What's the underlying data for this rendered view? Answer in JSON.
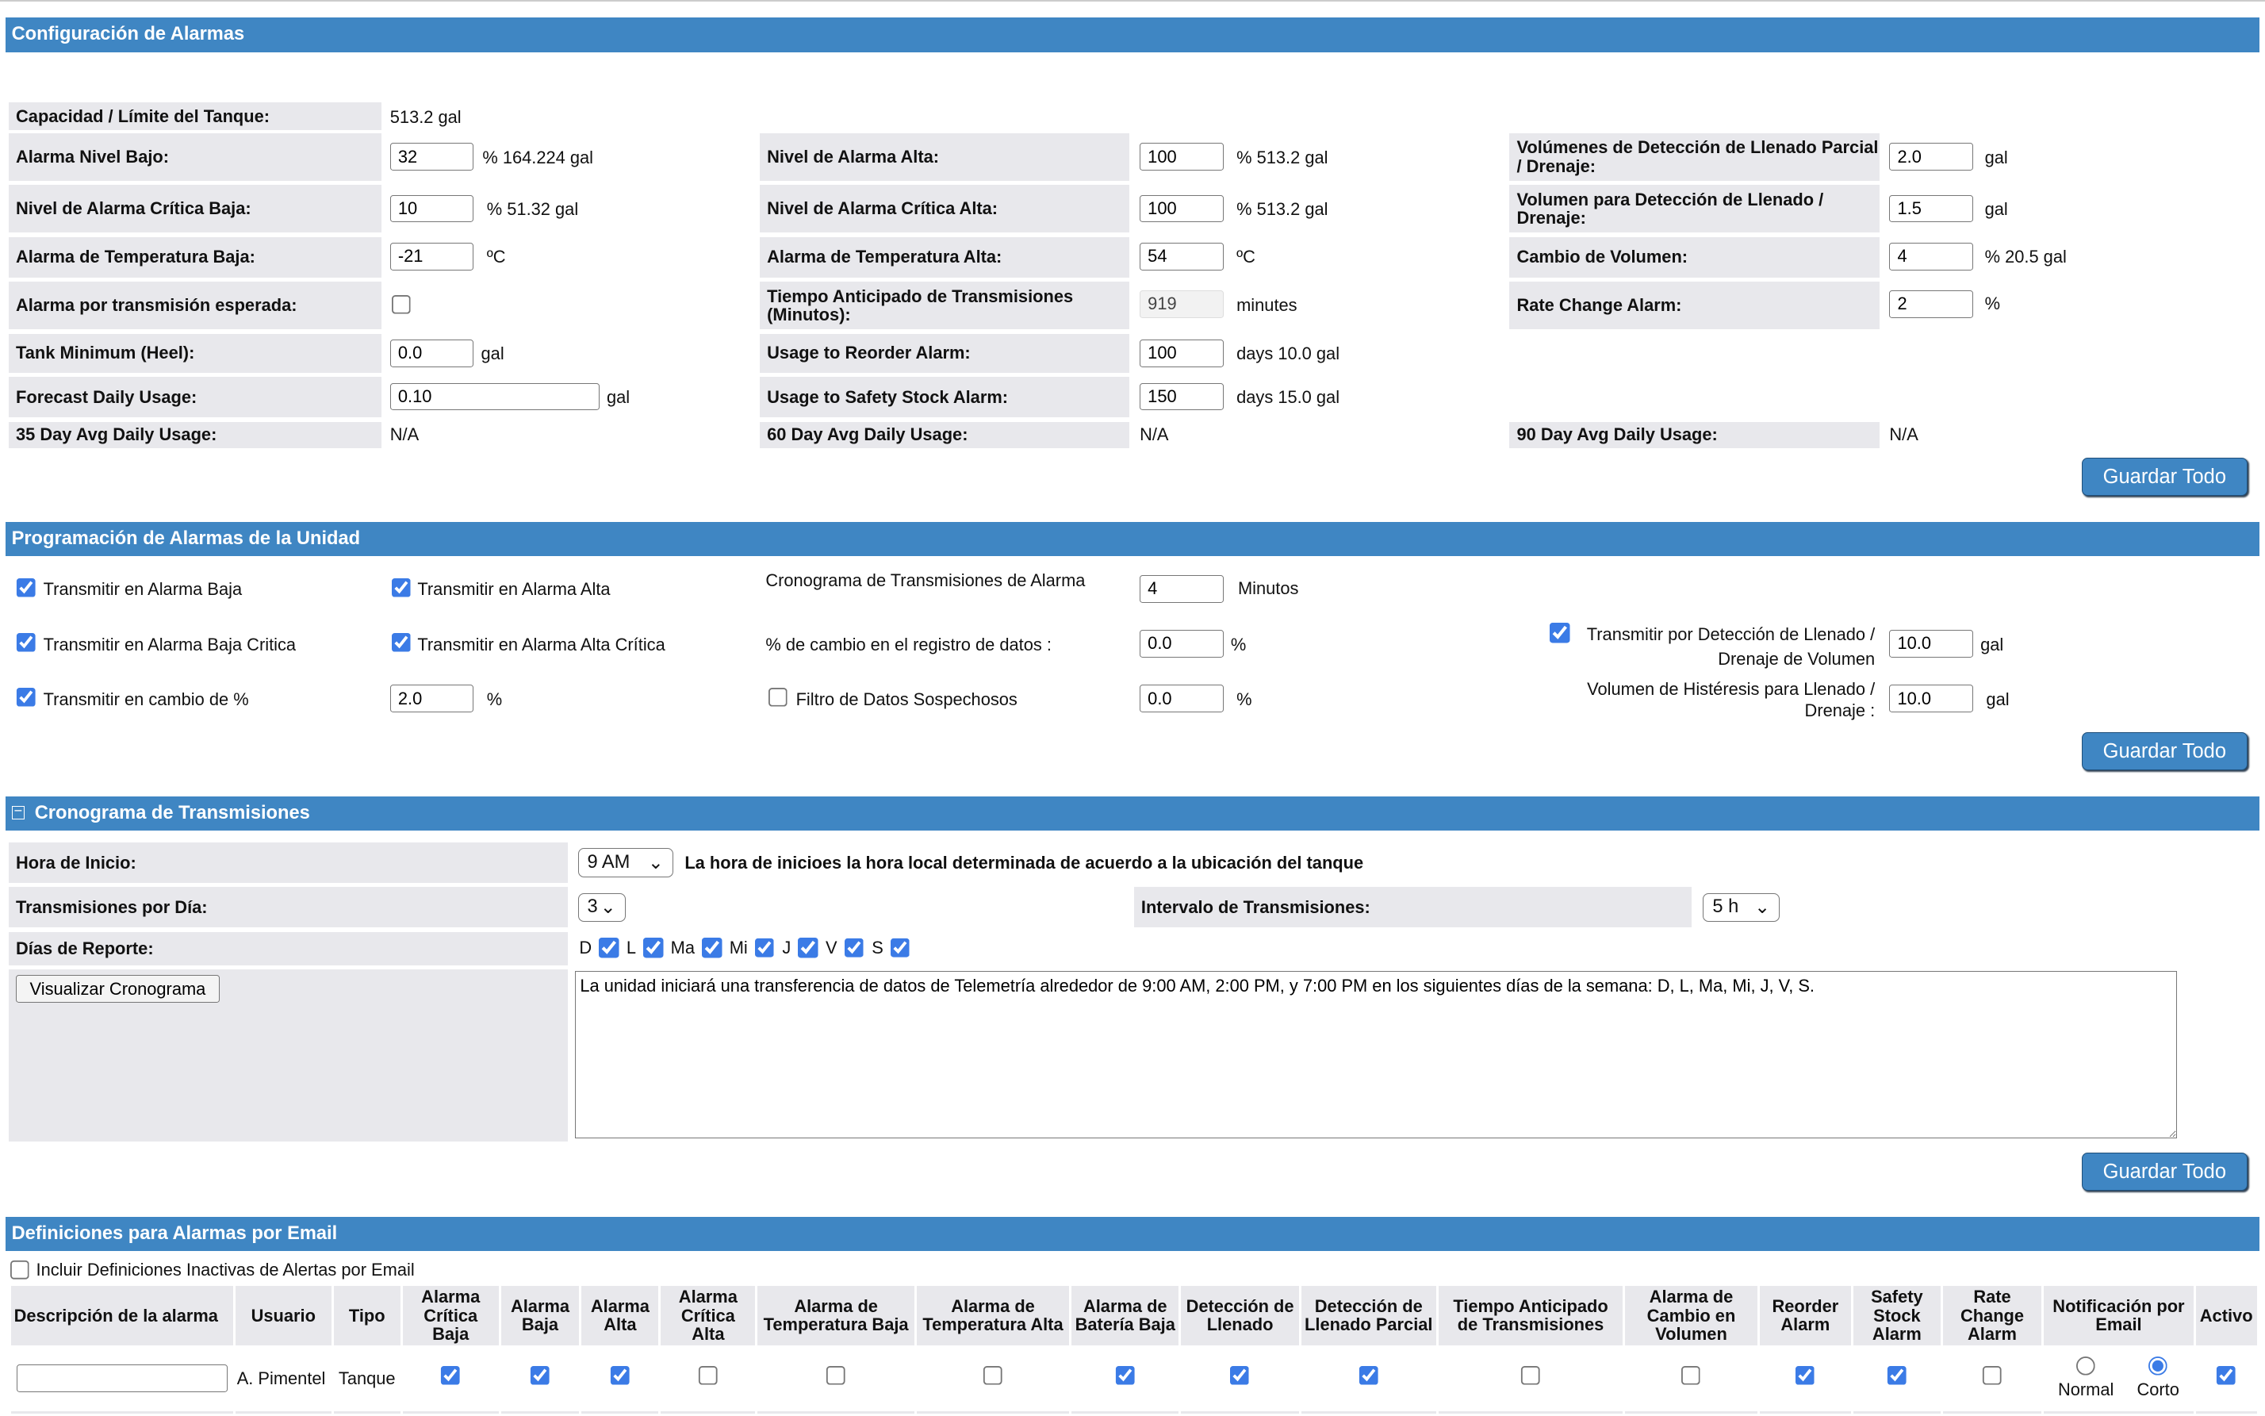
{
  "alarm_config": {
    "title": "Configuración de Alarmas",
    "capacity": {
      "label": "Capacidad / Límite del Tanque:",
      "value": "513.2  gal"
    },
    "low_alarm": {
      "label": "Alarma Nivel Bajo:",
      "value": "32",
      "suffix": "% 164.224  gal"
    },
    "crit_low": {
      "label": "Nivel de Alarma Crítica Baja:",
      "value": "10",
      "suffix": "%  51.32  gal"
    },
    "temp_low": {
      "label": "Alarma de Temperatura Baja:",
      "value": "-21",
      "suffix": "ºC"
    },
    "expected_tx": {
      "label": "Alarma por transmisión esperada:",
      "checked": false
    },
    "tank_min": {
      "label": "Tank Minimum (Heel):",
      "value": "0.0",
      "suffix": "gal"
    },
    "forecast": {
      "label": "Forecast Daily Usage:",
      "value": "0.10",
      "suffix": "gal"
    },
    "avg35": {
      "label": "35 Day Avg Daily Usage:",
      "value": "N/A"
    },
    "high_alarm": {
      "label": "Nivel de Alarma Alta:",
      "value": "100",
      "suffix": "%  513.2  gal"
    },
    "crit_high": {
      "label": "Nivel de Alarma Crítica Alta:",
      "value": "100",
      "suffix": "%  513.2  gal"
    },
    "temp_high": {
      "label": "Alarma de Temperatura Alta:",
      "value": "54",
      "suffix": "ºC"
    },
    "tx_lead": {
      "label": "Tiempo Anticipado de Transmisiones (Minutos):",
      "value": "919",
      "suffix": "minutes"
    },
    "reorder": {
      "label": "Usage to Reorder Alarm:",
      "value": "100",
      "suffix": "days 10.0 gal"
    },
    "safety": {
      "label": "Usage to Safety Stock Alarm:",
      "value": "150",
      "suffix": "days 15.0 gal"
    },
    "avg60": {
      "label": "60 Day Avg Daily Usage:",
      "value": "N/A"
    },
    "partial_fill": {
      "label": "Volúmenes de Detección de Llenado Parcial / Drenaje:",
      "value": "2.0",
      "suffix": "gal"
    },
    "fill_drain": {
      "label": "Volumen para Detección de Llenado / Drenaje:",
      "value": "1.5",
      "suffix": "gal"
    },
    "vol_change": {
      "label": "Cambio de Volumen:",
      "value": "4",
      "suffix": "%  20.5  gal"
    },
    "rate_change": {
      "label": "Rate Change Alarm:",
      "value": "2",
      "suffix": "%"
    },
    "avg90": {
      "label": "90 Day Avg Daily Usage:",
      "value": "N/A"
    },
    "save": "Guardar Todo"
  },
  "unit_schedule": {
    "title": "Programación de Alarmas de la Unidad",
    "tx_low": {
      "label": "Transmitir en Alarma Baja",
      "checked": true
    },
    "tx_high": {
      "label": "Transmitir en Alarma Alta",
      "checked": true
    },
    "tx_crit_low": {
      "label": "Transmitir en Alarma Baja Critica",
      "checked": true
    },
    "tx_crit_high": {
      "label": "Transmitir en Alarma Alta Crítica",
      "checked": true
    },
    "tx_pct": {
      "label": "Transmitir en cambio de %",
      "checked": true,
      "value": "2.0",
      "suffix": "%"
    },
    "alarm_tx_schedule": {
      "label": "Cronograma de Transmisiones de Alarma",
      "value": "4",
      "suffix": "Minutos"
    },
    "pct_change_log": {
      "label": "% de cambio en el registro de datos :",
      "value": "0.0",
      "suffix": "%"
    },
    "suspicious": {
      "label": "Filtro de Datos Sospechosos",
      "checked": false,
      "value": "0.0",
      "suffix": "%"
    },
    "tx_fill": {
      "label1": "Transmitir por Detección de Llenado /",
      "label2": "Drenaje de Volumen",
      "checked": true,
      "value": "10.0",
      "suffix": "gal"
    },
    "hysteresis": {
      "label1": "Volumen de Histéresis para Llenado /",
      "label2": "Drenaje :",
      "value": "10.0",
      "suffix": "gal"
    },
    "save": "Guardar Todo"
  },
  "tx_schedule": {
    "title": "Cronograma de Transmisiones",
    "collapse_icon": "minus-box",
    "start": {
      "label": "Hora de Inicio:",
      "value": "9 AM",
      "note": "La hora de inicioes la hora local determinada de acuerdo a la ubicación del tanque"
    },
    "per_day": {
      "label": "Transmisiones por Día:",
      "value": "3"
    },
    "interval": {
      "label": "Intervalo de Transmisiones:",
      "value": "5 h"
    },
    "days": {
      "label": "Días de Reporte:",
      "items": [
        {
          "d": "D",
          "c": true
        },
        {
          "d": "L",
          "c": true
        },
        {
          "d": "Ma",
          "c": true
        },
        {
          "d": "Mi",
          "c": true
        },
        {
          "d": "J",
          "c": true
        },
        {
          "d": "V",
          "c": true
        },
        {
          "d": "S",
          "c": true
        }
      ]
    },
    "view_button": "Visualizar Cronograma",
    "summary": "La unidad iniciará una transferencia de datos de Telemetría alrededor de 9:00 AM, 2:00 PM, y 7:00 PM en los siguientes días de la semana: D, L, Ma, Mi, J, V, S.",
    "save": "Guardar Todo"
  },
  "email": {
    "title": "Definiciones para Alarmas por Email",
    "include_inactive": {
      "label": "Incluir Definiciones Inactivas de Alertas por Email",
      "checked": false
    },
    "columns": [
      "Descripción de la alarma",
      "Usuario",
      "Tipo",
      "Alarma Crítica Baja",
      "Alarma Baja",
      "Alarma Alta",
      "Alarma Crítica Alta",
      "Alarma de Temperatura Baja",
      "Alarma de Temperatura Alta",
      "Alarma de Batería Baja",
      "Detección de Llenado",
      "Detección de Llenado Parcial",
      "Tiempo Anticipado de Transmisiones",
      "Alarma de Cambio en Volumen",
      "Reorder Alarm",
      "Safety Stock Alarm",
      "Rate Change Alarm",
      "Notificación por Email",
      "Activo"
    ],
    "rows": [
      {
        "description": "",
        "user": "A. Pimentel",
        "type": "Tanque",
        "checks": [
          true,
          true,
          true,
          false,
          false,
          false,
          true,
          true,
          true,
          false,
          false,
          true,
          true,
          false
        ],
        "notification": "Corto",
        "notify_options": [
          "Normal",
          "Corto"
        ],
        "active": true
      }
    ]
  },
  "colors": {
    "header": "#3f86c3",
    "label_bg": "#e8e8ec",
    "checkbox": "#3b7be6"
  }
}
